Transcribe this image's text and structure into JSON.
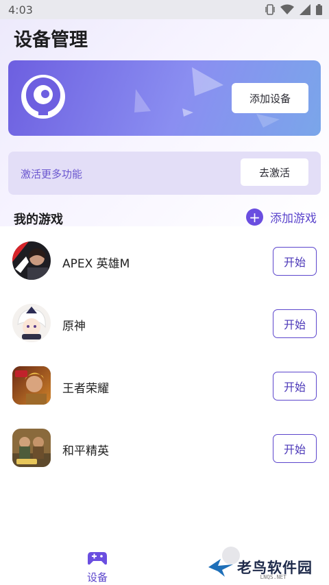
{
  "status_bar": {
    "time": "4:03"
  },
  "page": {
    "title": "设备管理"
  },
  "device_card": {
    "add_device_label": "添加设备"
  },
  "activate": {
    "text": "激活更多功能",
    "button_label": "去激活"
  },
  "games_section": {
    "title": "我的游戏",
    "add_game_label": "添加游戏"
  },
  "games": [
    {
      "name": "APEX 英雄M",
      "button": "开始",
      "icon": "apex-legends-mobile-icon"
    },
    {
      "name": "原神",
      "button": "开始",
      "icon": "genshin-impact-icon"
    },
    {
      "name": "王者荣耀",
      "button": "开始",
      "icon": "honor-of-kings-icon"
    },
    {
      "name": "和平精英",
      "button": "开始",
      "icon": "game-for-peace-icon"
    }
  ],
  "bottom_nav": {
    "device_label": "设备"
  },
  "watermark": {
    "text": "老鸟软件园",
    "sub": "LNQS.NET"
  },
  "colors": {
    "accent": "#5b45cc",
    "card_start": "#6d5fe0",
    "card_end": "#7aa6ea",
    "activate_bg": "#e3def7"
  }
}
